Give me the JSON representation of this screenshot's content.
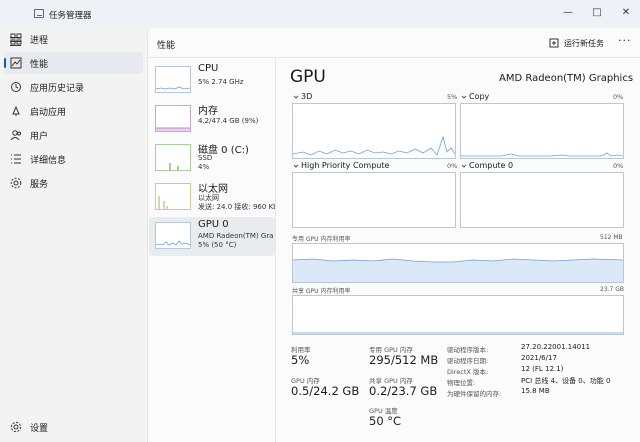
{
  "window": {
    "title": "任务管理器",
    "minimize": "—",
    "maximize": "□",
    "close": "✕"
  },
  "sidebar": {
    "items": [
      {
        "label": "进程",
        "icon": "grid-icon"
      },
      {
        "label": "性能",
        "icon": "performance-icon"
      },
      {
        "label": "应用历史记录",
        "icon": "history-icon"
      },
      {
        "label": "启动应用",
        "icon": "startup-icon"
      },
      {
        "label": "用户",
        "icon": "users-icon"
      },
      {
        "label": "详细信息",
        "icon": "details-icon"
      },
      {
        "label": "服务",
        "icon": "services-icon"
      }
    ],
    "settings": "设置"
  },
  "header": {
    "title": "性能",
    "run_task": "运行新任务",
    "more": "···"
  },
  "devices": [
    {
      "name": "CPU",
      "sub1": "5% 2.74 GHz"
    },
    {
      "name": "内存",
      "sub1": "4.2/47.4 GB (9%)"
    },
    {
      "name": "磁盘 0 (C:)",
      "sub1": "SSD",
      "sub2": "4%"
    },
    {
      "name": "以太网",
      "sub1": "以太网",
      "sub2": "发送: 24.0 接收: 960 Kbps"
    },
    {
      "name": "GPU 0",
      "sub1": "AMD Radeon(TM) Graphics",
      "sub2": "5% (50 °C)"
    }
  ],
  "gpu": {
    "title": "GPU",
    "model": "AMD Radeon(TM) Graphics",
    "engines": [
      {
        "name": "3D",
        "pct": "5%"
      },
      {
        "name": "Copy",
        "pct": "0%"
      },
      {
        "name": "High Priority Compute",
        "pct": "0%"
      },
      {
        "name": "Compute 0",
        "pct": "0%"
      }
    ],
    "dedicated_label": "专用 GPU 内存利用率",
    "dedicated_max": "512 MB",
    "shared_label": "共享 GPU 内存利用率",
    "shared_max": "23.7 GB",
    "stats": [
      {
        "label": "利用率",
        "value": "5%"
      },
      {
        "label": "专用 GPU 内存",
        "value": "295/512 MB"
      },
      {
        "label": "GPU 内存",
        "value": "0.5/24.2 GB"
      },
      {
        "label": "共享 GPU 内存",
        "value": "0.2/23.7 GB"
      },
      {
        "label": "GPU 温度",
        "value": "50 °C"
      }
    ],
    "details": [
      {
        "label": "驱动程序版本:",
        "value": "27.20.22001.14011"
      },
      {
        "label": "驱动程序日期:",
        "value": "2021/6/17"
      },
      {
        "label": "DirectX 版本:",
        "value": "12 (FL 12.1)"
      },
      {
        "label": "物理位置:",
        "value": "PCI 总线 4、设备 0、功能 0"
      },
      {
        "label": "为硬件保留的内存:",
        "value": "15.8 MB"
      }
    ]
  }
}
